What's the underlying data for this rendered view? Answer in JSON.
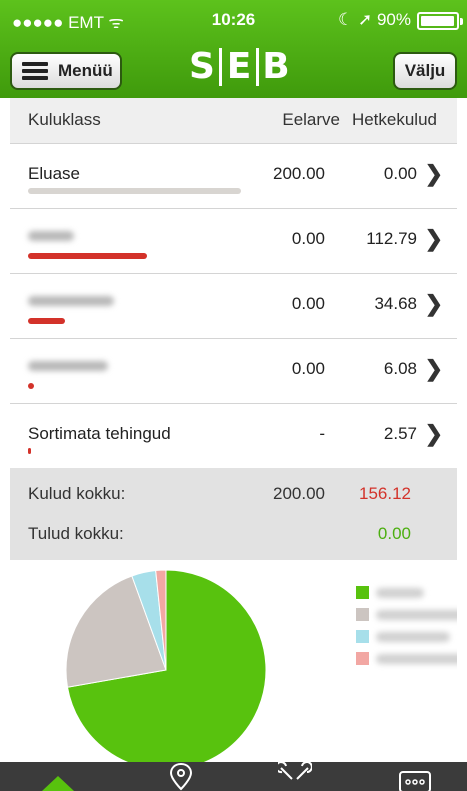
{
  "status_bar": {
    "carrier": "●●●●● EMT ᯤ",
    "time": "10:26",
    "right": "☾ ➚ 90%",
    "battery_level": 0.9
  },
  "header": {
    "menu_label": "Menüü",
    "logo_letters": [
      "S",
      "E",
      "B"
    ],
    "exit_label": "Välju"
  },
  "table": {
    "headers": {
      "category": "Kuluklass",
      "budget": "Eelarve",
      "actual": "Hetkekulud"
    },
    "rows": [
      {
        "name": "Eluase",
        "budget": "200.00",
        "actual": "0.00",
        "bar_color": "#d8d5d1",
        "bar_fraction": 0.52,
        "blurred": false
      },
      {
        "name": "",
        "budget": "0.00",
        "actual": "112.79",
        "bar_color": "#d3322a",
        "bar_fraction": 0.29,
        "blurred": true
      },
      {
        "name": "",
        "budget": "0.00",
        "actual": "34.68",
        "bar_color": "#d3322a",
        "bar_fraction": 0.09,
        "blurred": true
      },
      {
        "name": "",
        "budget": "0.00",
        "actual": "6.08",
        "bar_color": "#d3322a",
        "bar_fraction": 0.015,
        "blurred": true
      },
      {
        "name": "Sortimata tehingud",
        "budget": "-",
        "actual": "2.57",
        "bar_color": "#d3322a",
        "bar_fraction": 0.006,
        "blurred": false
      }
    ]
  },
  "totals": {
    "expenses_label": "Kulud kokku:",
    "expenses_budget": "200.00",
    "expenses_actual": "156.12",
    "income_label": "Tulud kokku:",
    "income_actual": "0.00",
    "expenses_color": "#d3322a",
    "income_color": "#4caf10"
  },
  "chart_data": {
    "type": "pie",
    "series": [
      {
        "value": 112.79,
        "color": "#58c20e"
      },
      {
        "value": 34.68,
        "color": "#ccc5c1"
      },
      {
        "value": 6.08,
        "color": "#a7dfea"
      },
      {
        "value": 2.57,
        "color": "#f2a7a3"
      }
    ],
    "legend_position": "right"
  },
  "tab_bar": [
    "home-icon",
    "location-icon",
    "tools-icon",
    "more-icon"
  ]
}
